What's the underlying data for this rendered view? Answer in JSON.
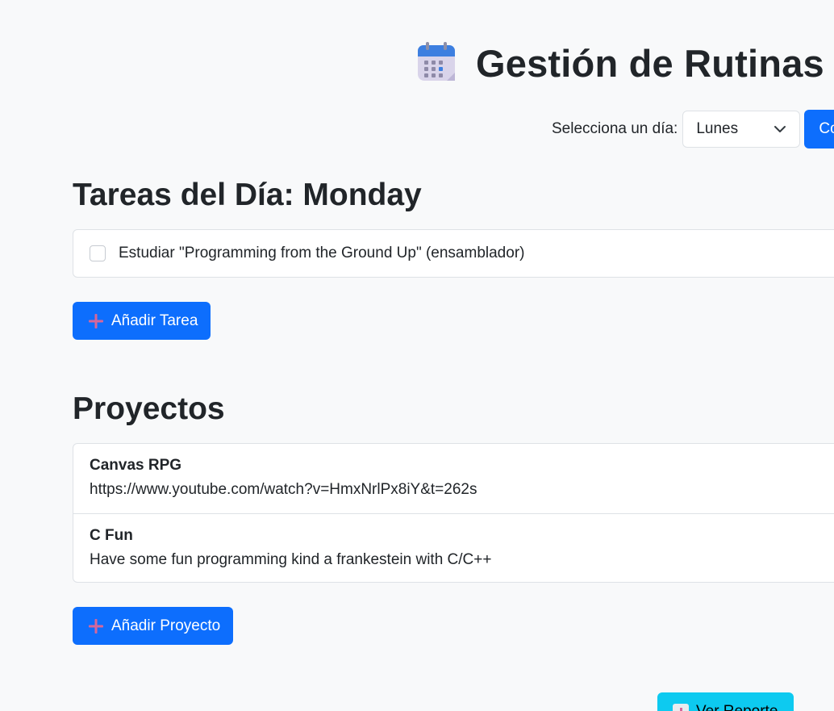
{
  "header": {
    "title": "Gestión de Rutinas y Proyectos",
    "icon": "calendar-icon"
  },
  "day_selector": {
    "label": "Selecciona un día:",
    "selected": "Lunes",
    "confirm_label": "Confirmar"
  },
  "tasks": {
    "heading": "Tareas del Día: Monday",
    "items": [
      {
        "label": "Estudiar \"Programming from the Ground Up\" (ensamblador)",
        "checked": false
      }
    ],
    "add_label": "Añadir Tarea"
  },
  "projects": {
    "heading": "Proyectos",
    "items": [
      {
        "name": "Canvas RPG",
        "description": "https://www.youtube.com/watch?v=HmxNrlPx8iY&t=262s"
      },
      {
        "name": "C Fun",
        "description": "Have some fun programming kind a frankestein with C/C++"
      }
    ],
    "add_label": "Añadir Proyecto"
  },
  "report": {
    "label": "Ver Reporte",
    "icon": "bar-chart-icon"
  },
  "colors": {
    "primary": "#0d6efd",
    "info": "#0dcaf0",
    "background": "#f8f9fa",
    "plus_icon": "#d6679a"
  }
}
